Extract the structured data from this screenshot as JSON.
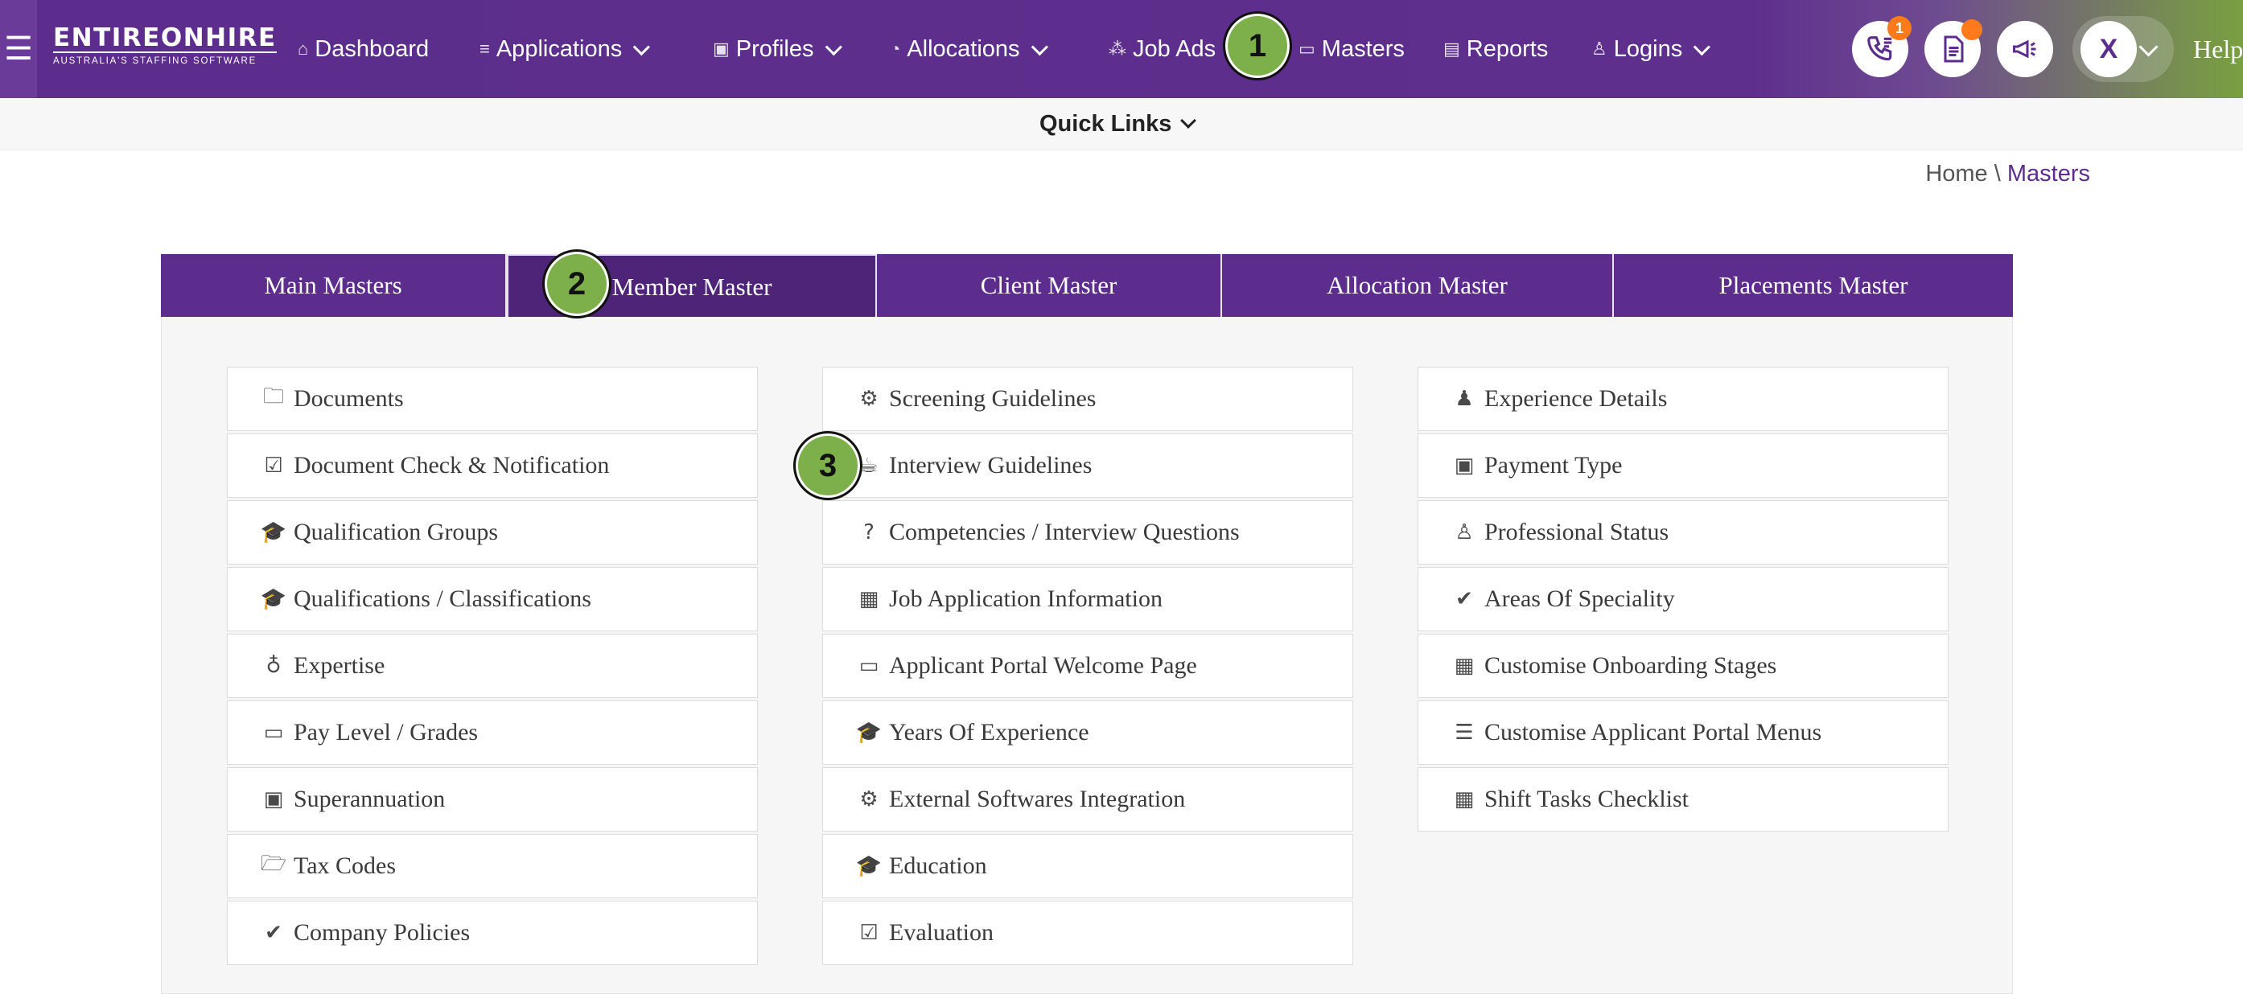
{
  "header": {
    "logo_main": "ENTIREONHIRE",
    "logo_sub": "AUSTRALIA'S STAFFING SOFTWARE",
    "menu_icon": "☰",
    "nav": [
      {
        "label": "Dashboard",
        "icon": "⌂"
      },
      {
        "label": "Applications",
        "icon": "≡"
      },
      {
        "label": "Profiles",
        "icon": "▣"
      },
      {
        "label": "Allocations",
        "icon": "◔"
      },
      {
        "label": "Job Ads",
        "icon": "⁂"
      },
      {
        "label": "Masters",
        "icon": "▭"
      },
      {
        "label": "Reports",
        "icon": "▤"
      },
      {
        "label": "Logins",
        "icon": "♙"
      }
    ],
    "phone_badge": "1",
    "avatar_letter": "X",
    "help_label": "Help"
  },
  "quick_links": {
    "label": "Quick Links"
  },
  "breadcrumb": {
    "home": "Home",
    "separator": " \\ ",
    "current": "Masters"
  },
  "tabs": [
    {
      "label": "Main Masters"
    },
    {
      "label": "Member Master"
    },
    {
      "label": "Client Master"
    },
    {
      "label": "Allocation Master"
    },
    {
      "label": "Placements Master"
    }
  ],
  "columns": {
    "left": [
      {
        "label": "Documents",
        "icon": "🗀"
      },
      {
        "label": "Document Check & Notification",
        "icon": "☑"
      },
      {
        "label": "Qualification Groups",
        "icon": "🎓"
      },
      {
        "label": "Qualifications / Classifications",
        "icon": "🎓"
      },
      {
        "label": "Expertise",
        "icon": "♁"
      },
      {
        "label": "Pay Level / Grades",
        "icon": "▭"
      },
      {
        "label": "Superannuation",
        "icon": "▣"
      },
      {
        "label": "Tax Codes",
        "icon": "🗁"
      },
      {
        "label": "Company Policies",
        "icon": "✔"
      }
    ],
    "middle": [
      {
        "label": "Screening Guidelines",
        "icon": "⚙"
      },
      {
        "label": "Interview Guidelines",
        "icon": "☕"
      },
      {
        "label": "Competencies / Interview Questions",
        "icon": "?"
      },
      {
        "label": "Job Application Information",
        "icon": "▦"
      },
      {
        "label": "Applicant Portal Welcome Page",
        "icon": "▭"
      },
      {
        "label": "Years Of Experience",
        "icon": "🎓"
      },
      {
        "label": "External Softwares Integration",
        "icon": "⚙"
      },
      {
        "label": "Education",
        "icon": "🎓"
      },
      {
        "label": "Evaluation",
        "icon": "☑"
      }
    ],
    "right": [
      {
        "label": "Experience Details",
        "icon": "♟"
      },
      {
        "label": "Payment Type",
        "icon": "▣"
      },
      {
        "label": "Professional Status",
        "icon": "♙"
      },
      {
        "label": "Areas Of Speciality",
        "icon": "✔"
      },
      {
        "label": "Customise Onboarding Stages",
        "icon": "▦"
      },
      {
        "label": "Customise Applicant Portal Menus",
        "icon": "☰"
      },
      {
        "label": "Shift Tasks Checklist",
        "icon": "▦"
      }
    ]
  },
  "steps": [
    "1",
    "2",
    "3"
  ],
  "colors": {
    "brand": "#5c2d8c",
    "step": "#7db04a",
    "badge": "#ff7a1a"
  }
}
